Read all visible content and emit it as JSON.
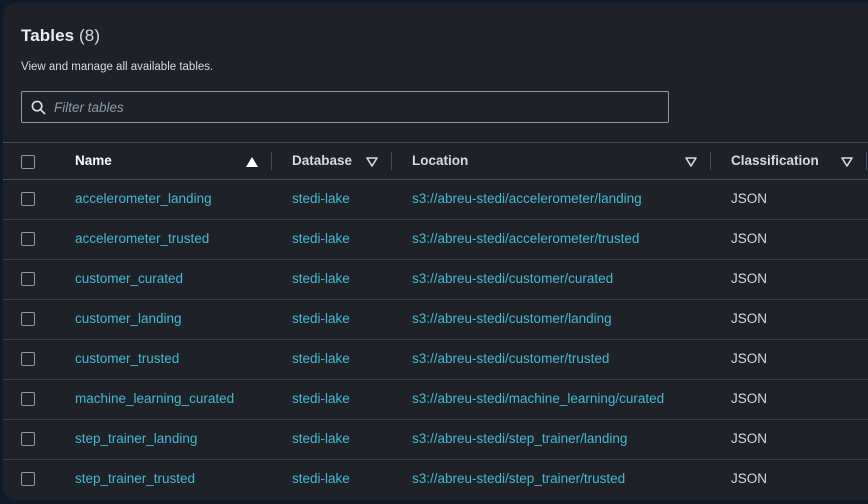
{
  "header": {
    "title": "Tables",
    "count": "(8)",
    "description": "View and manage all available tables."
  },
  "filter": {
    "placeholder": "Filter tables",
    "value": ""
  },
  "columns": {
    "name": "Name",
    "database": "Database",
    "location": "Location",
    "classification": "Classification"
  },
  "sort": {
    "column": "Name",
    "direction": "ascending"
  },
  "rows": [
    {
      "name": "accelerometer_landing",
      "database": "stedi-lake",
      "location": "s3://abreu-stedi/accelerometer/landing",
      "classification": "JSON"
    },
    {
      "name": "accelerometer_trusted",
      "database": "stedi-lake",
      "location": "s3://abreu-stedi/accelerometer/trusted",
      "classification": "JSON"
    },
    {
      "name": "customer_curated",
      "database": "stedi-lake",
      "location": "s3://abreu-stedi/customer/curated",
      "classification": "JSON"
    },
    {
      "name": "customer_landing",
      "database": "stedi-lake",
      "location": "s3://abreu-stedi/customer/landing",
      "classification": "JSON"
    },
    {
      "name": "customer_trusted",
      "database": "stedi-lake",
      "location": "s3://abreu-stedi/customer/trusted",
      "classification": "JSON"
    },
    {
      "name": "machine_learning_curated",
      "database": "stedi-lake",
      "location": "s3://abreu-stedi/machine_learning/curated",
      "classification": "JSON"
    },
    {
      "name": "step_trainer_landing",
      "database": "stedi-lake",
      "location": "s3://abreu-stedi/step_trainer/landing",
      "classification": "JSON"
    },
    {
      "name": "step_trainer_trusted",
      "database": "stedi-lake",
      "location": "s3://abreu-stedi/step_trainer/trusted",
      "classification": "JSON"
    }
  ],
  "colors": {
    "background": "#1e2228",
    "link": "#44b9d6",
    "text": "#d5dbdb",
    "border": "#414d5c"
  }
}
